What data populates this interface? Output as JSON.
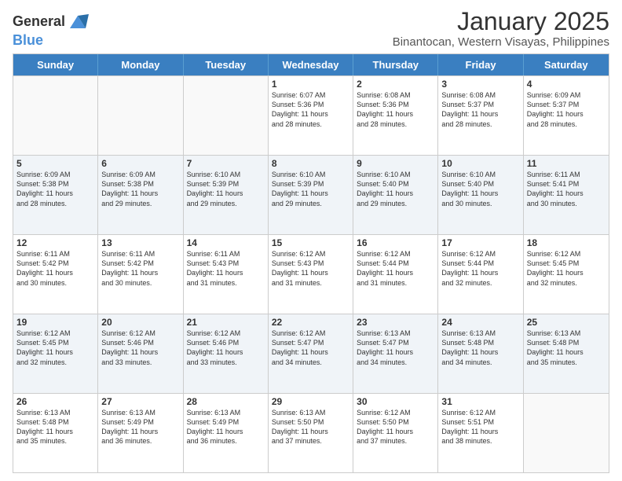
{
  "logo": {
    "line1": "General",
    "line2": "Blue"
  },
  "title": "January 2025",
  "subtitle": "Binantocan, Western Visayas, Philippines",
  "header_days": [
    "Sunday",
    "Monday",
    "Tuesday",
    "Wednesday",
    "Thursday",
    "Friday",
    "Saturday"
  ],
  "weeks": [
    [
      {
        "day": "",
        "info": "",
        "empty": true
      },
      {
        "day": "",
        "info": "",
        "empty": true
      },
      {
        "day": "",
        "info": "",
        "empty": true
      },
      {
        "day": "1",
        "info": "Sunrise: 6:07 AM\nSunset: 5:36 PM\nDaylight: 11 hours\nand 28 minutes."
      },
      {
        "day": "2",
        "info": "Sunrise: 6:08 AM\nSunset: 5:36 PM\nDaylight: 11 hours\nand 28 minutes."
      },
      {
        "day": "3",
        "info": "Sunrise: 6:08 AM\nSunset: 5:37 PM\nDaylight: 11 hours\nand 28 minutes."
      },
      {
        "day": "4",
        "info": "Sunrise: 6:09 AM\nSunset: 5:37 PM\nDaylight: 11 hours\nand 28 minutes."
      }
    ],
    [
      {
        "day": "5",
        "info": "Sunrise: 6:09 AM\nSunset: 5:38 PM\nDaylight: 11 hours\nand 28 minutes."
      },
      {
        "day": "6",
        "info": "Sunrise: 6:09 AM\nSunset: 5:38 PM\nDaylight: 11 hours\nand 29 minutes."
      },
      {
        "day": "7",
        "info": "Sunrise: 6:10 AM\nSunset: 5:39 PM\nDaylight: 11 hours\nand 29 minutes."
      },
      {
        "day": "8",
        "info": "Sunrise: 6:10 AM\nSunset: 5:39 PM\nDaylight: 11 hours\nand 29 minutes."
      },
      {
        "day": "9",
        "info": "Sunrise: 6:10 AM\nSunset: 5:40 PM\nDaylight: 11 hours\nand 29 minutes."
      },
      {
        "day": "10",
        "info": "Sunrise: 6:10 AM\nSunset: 5:40 PM\nDaylight: 11 hours\nand 30 minutes."
      },
      {
        "day": "11",
        "info": "Sunrise: 6:11 AM\nSunset: 5:41 PM\nDaylight: 11 hours\nand 30 minutes."
      }
    ],
    [
      {
        "day": "12",
        "info": "Sunrise: 6:11 AM\nSunset: 5:42 PM\nDaylight: 11 hours\nand 30 minutes."
      },
      {
        "day": "13",
        "info": "Sunrise: 6:11 AM\nSunset: 5:42 PM\nDaylight: 11 hours\nand 30 minutes."
      },
      {
        "day": "14",
        "info": "Sunrise: 6:11 AM\nSunset: 5:43 PM\nDaylight: 11 hours\nand 31 minutes."
      },
      {
        "day": "15",
        "info": "Sunrise: 6:12 AM\nSunset: 5:43 PM\nDaylight: 11 hours\nand 31 minutes."
      },
      {
        "day": "16",
        "info": "Sunrise: 6:12 AM\nSunset: 5:44 PM\nDaylight: 11 hours\nand 31 minutes."
      },
      {
        "day": "17",
        "info": "Sunrise: 6:12 AM\nSunset: 5:44 PM\nDaylight: 11 hours\nand 32 minutes."
      },
      {
        "day": "18",
        "info": "Sunrise: 6:12 AM\nSunset: 5:45 PM\nDaylight: 11 hours\nand 32 minutes."
      }
    ],
    [
      {
        "day": "19",
        "info": "Sunrise: 6:12 AM\nSunset: 5:45 PM\nDaylight: 11 hours\nand 32 minutes."
      },
      {
        "day": "20",
        "info": "Sunrise: 6:12 AM\nSunset: 5:46 PM\nDaylight: 11 hours\nand 33 minutes."
      },
      {
        "day": "21",
        "info": "Sunrise: 6:12 AM\nSunset: 5:46 PM\nDaylight: 11 hours\nand 33 minutes."
      },
      {
        "day": "22",
        "info": "Sunrise: 6:12 AM\nSunset: 5:47 PM\nDaylight: 11 hours\nand 34 minutes."
      },
      {
        "day": "23",
        "info": "Sunrise: 6:13 AM\nSunset: 5:47 PM\nDaylight: 11 hours\nand 34 minutes."
      },
      {
        "day": "24",
        "info": "Sunrise: 6:13 AM\nSunset: 5:48 PM\nDaylight: 11 hours\nand 34 minutes."
      },
      {
        "day": "25",
        "info": "Sunrise: 6:13 AM\nSunset: 5:48 PM\nDaylight: 11 hours\nand 35 minutes."
      }
    ],
    [
      {
        "day": "26",
        "info": "Sunrise: 6:13 AM\nSunset: 5:48 PM\nDaylight: 11 hours\nand 35 minutes."
      },
      {
        "day": "27",
        "info": "Sunrise: 6:13 AM\nSunset: 5:49 PM\nDaylight: 11 hours\nand 36 minutes."
      },
      {
        "day": "28",
        "info": "Sunrise: 6:13 AM\nSunset: 5:49 PM\nDaylight: 11 hours\nand 36 minutes."
      },
      {
        "day": "29",
        "info": "Sunrise: 6:13 AM\nSunset: 5:50 PM\nDaylight: 11 hours\nand 37 minutes."
      },
      {
        "day": "30",
        "info": "Sunrise: 6:12 AM\nSunset: 5:50 PM\nDaylight: 11 hours\nand 37 minutes."
      },
      {
        "day": "31",
        "info": "Sunrise: 6:12 AM\nSunset: 5:51 PM\nDaylight: 11 hours\nand 38 minutes."
      },
      {
        "day": "",
        "info": "",
        "empty": true
      }
    ]
  ]
}
